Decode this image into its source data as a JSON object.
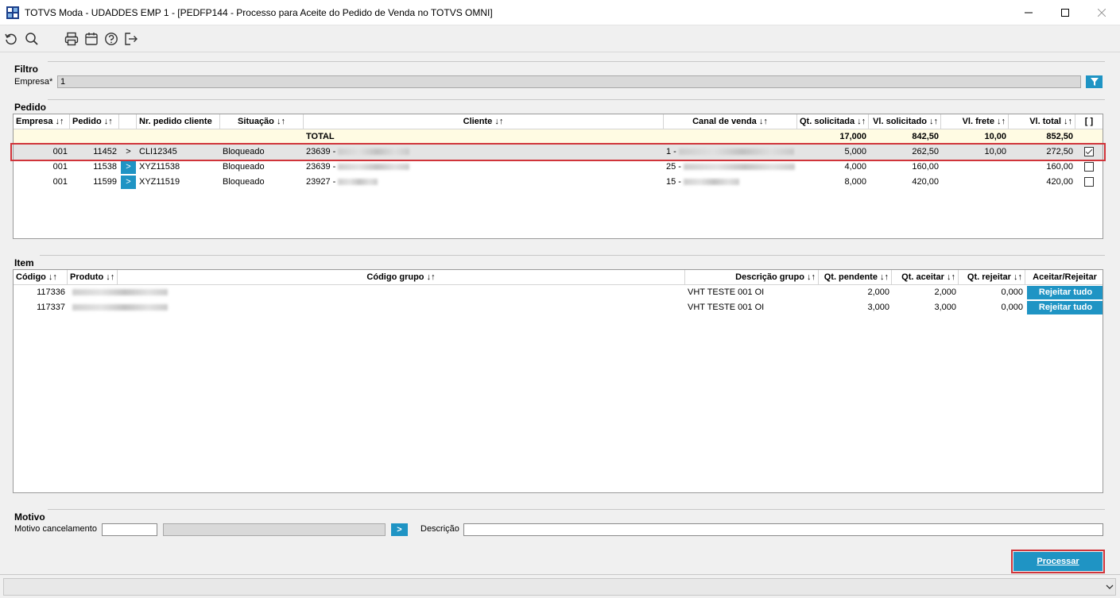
{
  "window": {
    "title": "TOTVS Moda - UDADDES EMP 1 - [PEDFP144 - Processo para Aceite do Pedido de Venda no TOTVS OMNI]",
    "minimize_icon": "minimize-icon",
    "maximize_icon": "maximize-icon",
    "close_icon": "close-icon"
  },
  "toolbar": {
    "icons": [
      "refresh-icon",
      "search-icon",
      "print-icon",
      "calendar-icon",
      "help-icon",
      "exit-icon"
    ]
  },
  "filtro": {
    "title": "Filtro",
    "empresa_label": "Empresa*",
    "empresa_value": "1"
  },
  "pedido": {
    "title": "Pedido",
    "headers": {
      "empresa": "Empresa ↓↑",
      "pedido": "Pedido ↓↑",
      "nr_pedido_cliente": "Nr. pedido cliente",
      "situacao": "Situação ↓↑",
      "cliente": "Cliente ↓↑",
      "canal_venda": "Canal de venda ↓↑",
      "qt_solicitada": "Qt. solicitada ↓↑",
      "vl_solicitado": "Vl. solicitado ↓↑",
      "vl_frete": "Vl. frete ↓↑",
      "vl_total": "Vl. total ↓↑",
      "select_all": "[ ]"
    },
    "total": {
      "label": "TOTAL",
      "qt_solicitada": "17,000",
      "vl_solicitado": "842,50",
      "vl_frete": "10,00",
      "vl_total": "852,50"
    },
    "rows": [
      {
        "empresa": "001",
        "pedido": "11452",
        "arrow": ">",
        "nr_pedido_cliente": "CLI12345",
        "situacao": "Bloqueado",
        "cliente": "23639 -",
        "canal_venda": "1 -",
        "qt_solicitada": "5,000",
        "vl_solicitado": "262,50",
        "vl_frete": "10,00",
        "vl_total": "272,50",
        "checked": true
      },
      {
        "empresa": "001",
        "pedido": "11538",
        "arrow": ">",
        "nr_pedido_cliente": "XYZ11538",
        "situacao": "Bloqueado",
        "cliente": "23639 -",
        "canal_venda": "25 -",
        "qt_solicitada": "4,000",
        "vl_solicitado": "160,00",
        "vl_frete": "",
        "vl_total": "160,00",
        "checked": false
      },
      {
        "empresa": "001",
        "pedido": "11599",
        "arrow": ">",
        "nr_pedido_cliente": "XYZ11519",
        "situacao": "Bloqueado",
        "cliente": "23927 -",
        "canal_venda": "15 -",
        "qt_solicitada": "8,000",
        "vl_solicitado": "420,00",
        "vl_frete": "",
        "vl_total": "420,00",
        "checked": false
      }
    ]
  },
  "item": {
    "title": "Item",
    "headers": {
      "codigo": "Código ↓↑",
      "produto": "Produto ↓↑",
      "codigo_grupo": "Código grupo ↓↑",
      "descricao_grupo": "Descrição grupo ↓↑",
      "qt_pendente": "Qt. pendente ↓↑",
      "qt_aceitar": "Qt. aceitar ↓↑",
      "qt_rejeitar": "Qt. rejeitar ↓↑",
      "aceitar_rejeitar": "Aceitar/Rejeitar"
    },
    "rows": [
      {
        "codigo": "117336",
        "descricao_grupo": "VHT TESTE 001 OI",
        "qt_pendente": "2,000",
        "qt_aceitar": "2,000",
        "qt_rejeitar": "0,000",
        "action": "Rejeitar tudo"
      },
      {
        "codigo": "117337",
        "descricao_grupo": "VHT TESTE 001 OI",
        "qt_pendente": "3,000",
        "qt_aceitar": "3,000",
        "qt_rejeitar": "0,000",
        "action": "Rejeitar tudo"
      }
    ]
  },
  "motivo": {
    "title": "Motivo",
    "cancelamento_label": "Motivo cancelamento",
    "descricao_label": "Descrição",
    "lookup_arrow": ">"
  },
  "actions": {
    "processar": "Processar"
  },
  "colors": {
    "accent": "#1f94c4",
    "highlight_border": "#d0343a",
    "total_row": "#fffbe3",
    "selected_row": "#e4e4e4"
  }
}
